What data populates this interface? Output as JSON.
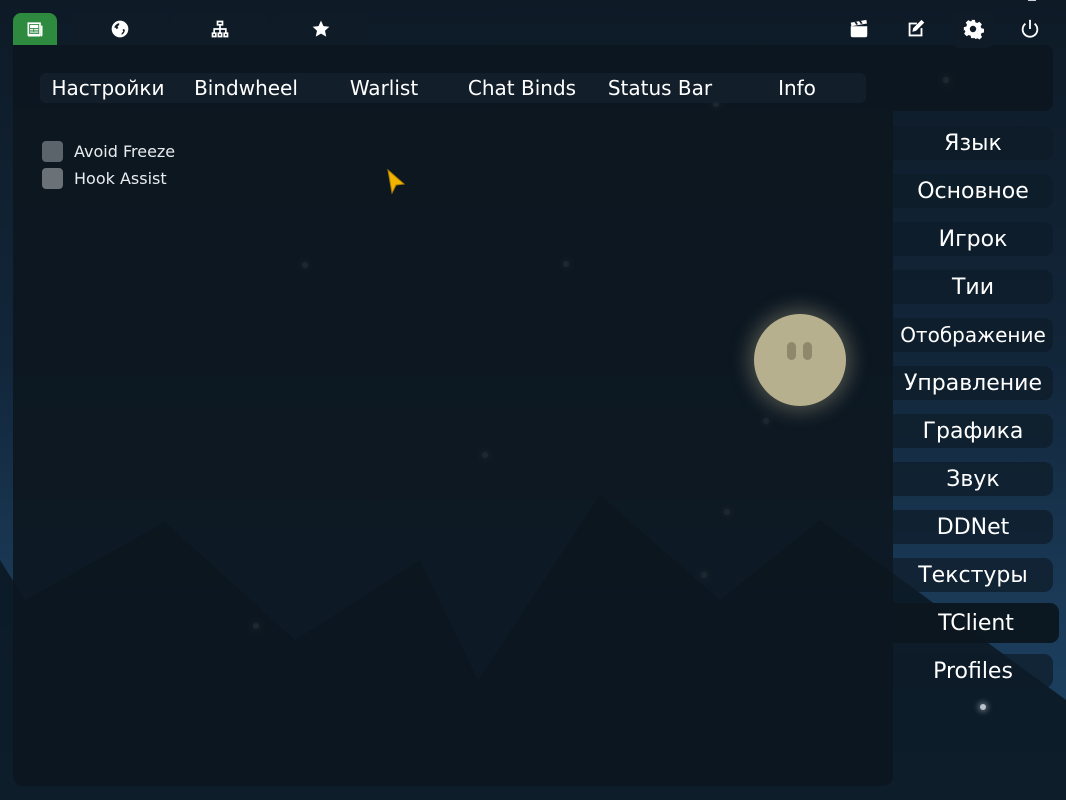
{
  "top_tabs": [
    {
      "icon": "newspaper-icon"
    },
    {
      "icon": "globe-icon"
    },
    {
      "icon": "network-icon"
    },
    {
      "icon": "star-icon"
    }
  ],
  "right_buttons": [
    {
      "icon": "clapperboard-icon"
    },
    {
      "icon": "edit-icon"
    },
    {
      "icon": "gear-icon"
    },
    {
      "icon": "power-icon"
    }
  ],
  "sub_tabs": [
    "Настройки",
    "Bindwheel",
    "Warlist",
    "Chat Binds",
    "Status Bar",
    "Info"
  ],
  "options": [
    {
      "label": "Avoid Freeze",
      "checked": false
    },
    {
      "label": "Hook Assist",
      "checked": false
    }
  ],
  "settings_menu": [
    "Язык",
    "Основное",
    "Игрок",
    "Тии",
    "Отображение",
    "Управление",
    "Графика",
    "Звук",
    "DDNet",
    "Текстуры",
    "TClient",
    "Profiles"
  ],
  "active_menu": "TClient",
  "colors": {
    "active_tab": "#2d8a3f",
    "panel": "#0c161f",
    "moon": "#b7b08e",
    "cursor": "#f0b400"
  }
}
